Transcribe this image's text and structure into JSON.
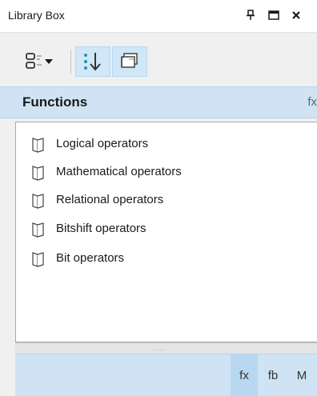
{
  "window": {
    "title": "Library Box",
    "pin_icon": "pin-icon",
    "maximize_icon": "maximize-icon",
    "close_icon": "close-icon"
  },
  "toolbar": {
    "view_mode_icon": "view-mode-dropdown-icon",
    "sort_icon": "sort-icon",
    "group_icon": "group-icon"
  },
  "section": {
    "title": "Functions",
    "icon_text": "fx"
  },
  "items": [
    {
      "label": "Logical operators"
    },
    {
      "label": "Mathematical operators"
    },
    {
      "label": "Relational operators"
    },
    {
      "label": "Bitshift operators"
    },
    {
      "label": "Bit operators"
    }
  ],
  "splitter": {
    "grip": "....."
  },
  "bottom_tabs": [
    {
      "label": "fx",
      "active": true
    },
    {
      "label": "fb",
      "active": false
    },
    {
      "label": "M",
      "active": false
    }
  ],
  "colors": {
    "accent": "#cfe3f4",
    "active_tab": "#b8d7f0",
    "tool_active": "#cfe7f7",
    "sort_icon": "#2d8fb0"
  }
}
